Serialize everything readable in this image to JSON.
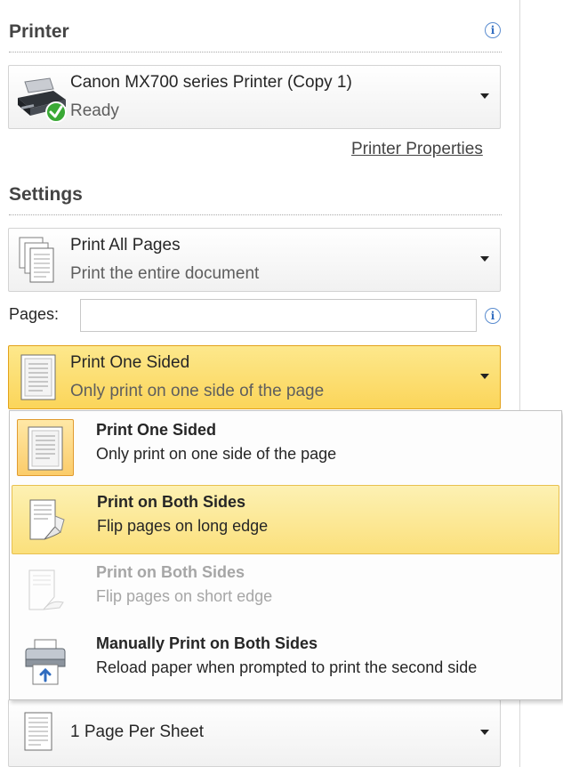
{
  "printer_section": {
    "title": "Printer",
    "printer_name": "Canon MX700 series Printer (Copy 1)",
    "printer_status": "Ready",
    "properties_link": "Printer Properties"
  },
  "settings_section": {
    "title": "Settings",
    "print_range": {
      "title": "Print All Pages",
      "subtitle": "Print the entire document"
    },
    "pages_label": "Pages:",
    "pages_value": "",
    "sides": {
      "title": "Print One Sided",
      "subtitle": "Only print on one side of the page"
    },
    "sides_menu": [
      {
        "title": "Print One Sided",
        "subtitle": "Only print on one side of the page",
        "state": "selected"
      },
      {
        "title": "Print on Both Sides",
        "subtitle": "Flip pages on long edge",
        "state": "hover"
      },
      {
        "title": "Print on Both Sides",
        "subtitle": "Flip pages on short edge",
        "state": "disabled"
      },
      {
        "title": "Manually Print on Both Sides",
        "subtitle": "Reload paper when prompted to print the second side",
        "state": "normal"
      }
    ],
    "per_sheet": {
      "title": "1 Page Per Sheet"
    }
  },
  "icons": {
    "info": "info-icon",
    "printer": "printer-icon",
    "ready": "ready-check-icon",
    "dropdown": "chevron-down-icon"
  },
  "colors": {
    "accent_highlight": "#fbd55a",
    "accent_border": "#e3a21a",
    "ready_green": "#3aa935"
  }
}
